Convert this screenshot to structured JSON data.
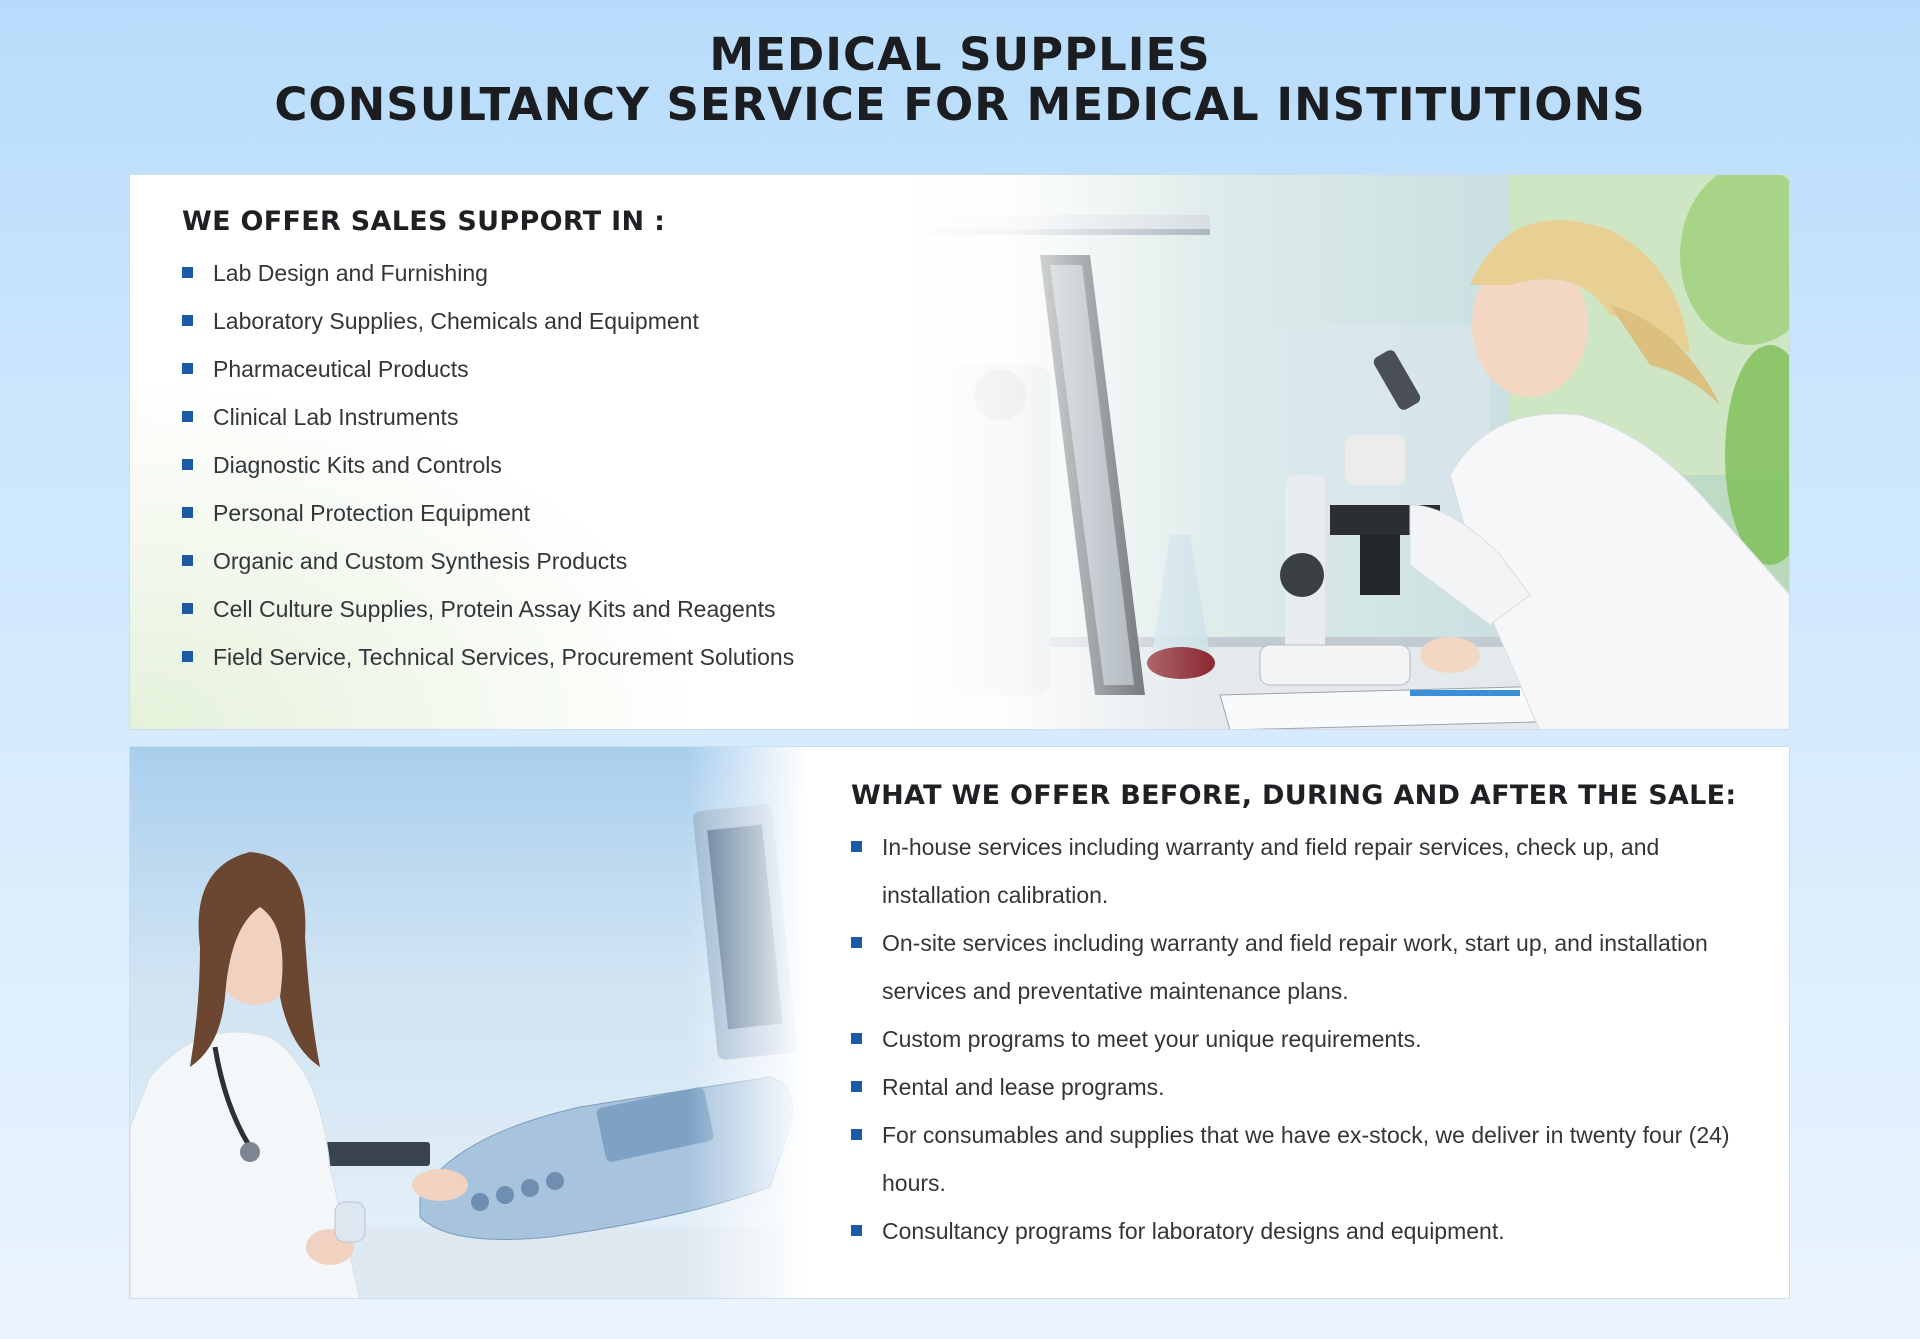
{
  "header": {
    "line1": "MEDICAL SUPPLIES",
    "line2": "CONSULTANCY SERVICE FOR MEDICAL INSTITUTIONS"
  },
  "section1": {
    "title": "WE OFFER SALES SUPPORT IN :",
    "items": [
      "Lab Design and Furnishing",
      "Laboratory Supplies, Chemicals and Equipment",
      "Pharmaceutical Products",
      "Clinical Lab Instruments",
      "Diagnostic Kits and Controls",
      "Personal Protection Equipment",
      "Organic and Custom Synthesis Products",
      "Cell Culture Supplies, Protein Assay Kits and Reagents",
      "Field Service, Technical Services, Procurement Solutions"
    ]
  },
  "section2": {
    "title": "WHAT WE OFFER BEFORE, DURING AND AFTER THE SALE:",
    "items": [
      "In-house services including warranty and field repair services, check up, and installation calibration.",
      "On-site services including warranty and field repair work, start up, and installation services and preventative maintenance plans.",
      "Custom programs to meet your unique requirements.",
      "Rental and lease programs.",
      "For consumables and supplies that we have ex-stock, we deliver in twenty four (24) hours.",
      "Consultancy programs for laboratory designs and equipment."
    ]
  },
  "colors": {
    "bullet": "#1c5aa5",
    "title": "#1e2024",
    "text": "#333639",
    "background_top": "#b7dcfb",
    "background_bottom": "#eaf4fe"
  }
}
